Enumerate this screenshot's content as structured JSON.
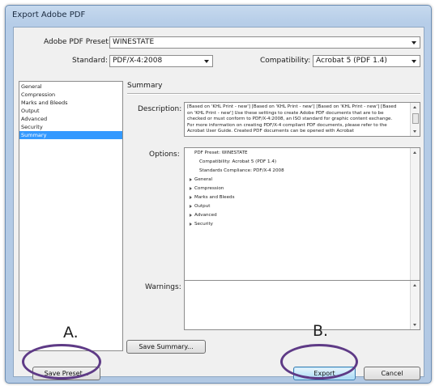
{
  "window": {
    "title": "Export Adobe PDF"
  },
  "preset": {
    "label": "Adobe PDF Preset:",
    "value": "WINESTATE"
  },
  "standard": {
    "label": "Standard:",
    "value": "PDF/X-4:2008"
  },
  "compatibility": {
    "label": "Compatibility:",
    "value": "Acrobat 5 (PDF 1.4)"
  },
  "sidebar": {
    "items": [
      {
        "label": "General",
        "selected": false
      },
      {
        "label": "Compression",
        "selected": false
      },
      {
        "label": "Marks and Bleeds",
        "selected": false
      },
      {
        "label": "Output",
        "selected": false
      },
      {
        "label": "Advanced",
        "selected": false
      },
      {
        "label": "Security",
        "selected": false
      },
      {
        "label": "Summary",
        "selected": true
      }
    ]
  },
  "summary": {
    "section_title": "Summary",
    "description_label": "Description:",
    "description_text": "[Based on 'KHL Print - new'] [Based on 'KHL Print - new'] [Based on 'KHL Print - new'] [Based on 'KHL Print - new'] Use these settings to create Adobe PDF documents that are to be checked or must conform to PDF/X-4:2008, an ISO standard for graphic content exchange.  For more information on creating PDF/X-4 compliant PDF documents, please refer to the Acrobat User Guide.  Created PDF documents can be opened with Acrobat",
    "options_label": "Options:",
    "options": {
      "preset_line": "PDF Preset: WINESTATE",
      "compat_line": "Compatibility: Acrobat 5 (PDF 1.4)",
      "standards_line": "Standards Compliance: PDF/X-4 2008",
      "groups": [
        "General",
        "Compression",
        "Marks and Bleeds",
        "Output",
        "Advanced",
        "Security"
      ]
    },
    "warnings_label": "Warnings:",
    "save_summary_label": "Save Summary..."
  },
  "buttons": {
    "save_preset": "Save Preset...",
    "export": "Export",
    "cancel": "Cancel"
  },
  "annotations": {
    "a_label": "A.",
    "b_label": "B.",
    "ellipse_color": "#5e3a86"
  },
  "colors": {
    "selection": "#3399ff",
    "frame": "#b6cde8"
  }
}
